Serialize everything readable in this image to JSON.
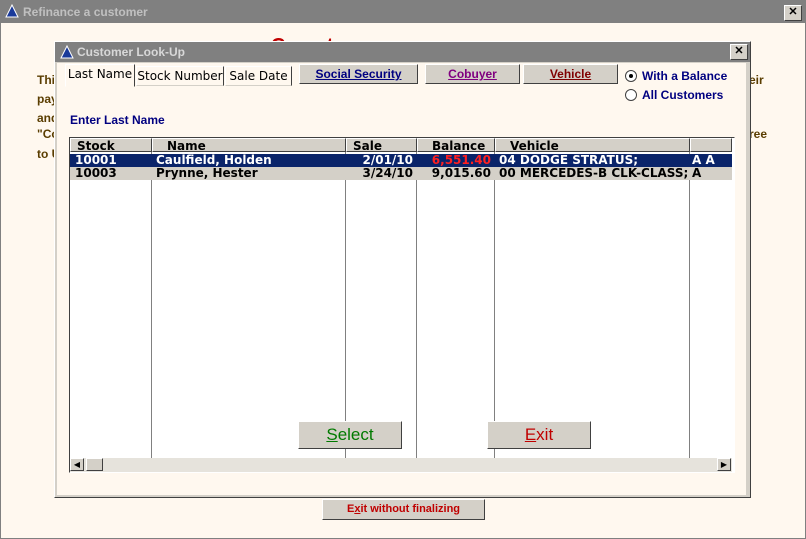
{
  "outer_window": {
    "title": "Refinance a customer",
    "close": "✕",
    "bg_title": "Customer Refinancing",
    "bg_left_lines": [
      "Thi",
      "pay",
      "and",
      "\"Co",
      "to U"
    ],
    "bg_right_lines": [
      "eir",
      "ree"
    ]
  },
  "dialog": {
    "title": "Customer Look-Up",
    "close": "✕",
    "tabs": [
      "Last Name",
      "Stock Number",
      "Sale Date"
    ],
    "active_tab": "Last Name",
    "search_buttons": [
      {
        "label": "Social Security",
        "color": "#000080"
      },
      {
        "label": "Cobuyer",
        "color": "#800080"
      },
      {
        "label": "Vehicle",
        "color": "#800000"
      }
    ],
    "radios": [
      {
        "label": "With a Balance",
        "checked": true
      },
      {
        "label": "All Customers",
        "checked": false
      }
    ],
    "enter_label": "Enter Last Name",
    "table": {
      "columns": [
        "Stock",
        "Name",
        "Sale Date",
        "Balance",
        "Vehicle",
        ""
      ],
      "rows": [
        {
          "stock": "10001",
          "name": "Caulfield, Holden",
          "sale_date": "2/01/10",
          "balance": "6,551.40",
          "vehicle": "04 DODGE STRATUS;",
          "extra": "A A",
          "selected": true,
          "balance_color": "#ff2020"
        },
        {
          "stock": "10003",
          "name": "Prynne, Hester",
          "sale_date": "3/24/10",
          "balance": "9,015.60",
          "vehicle": "00 MERCEDES-B CLK-CLASS;",
          "extra": "A",
          "selected": false,
          "balance_color": "#000000"
        }
      ]
    },
    "select_button": "Select",
    "exit_button": "Exit"
  },
  "exit_without_finalizing": "Exit without finalizing"
}
